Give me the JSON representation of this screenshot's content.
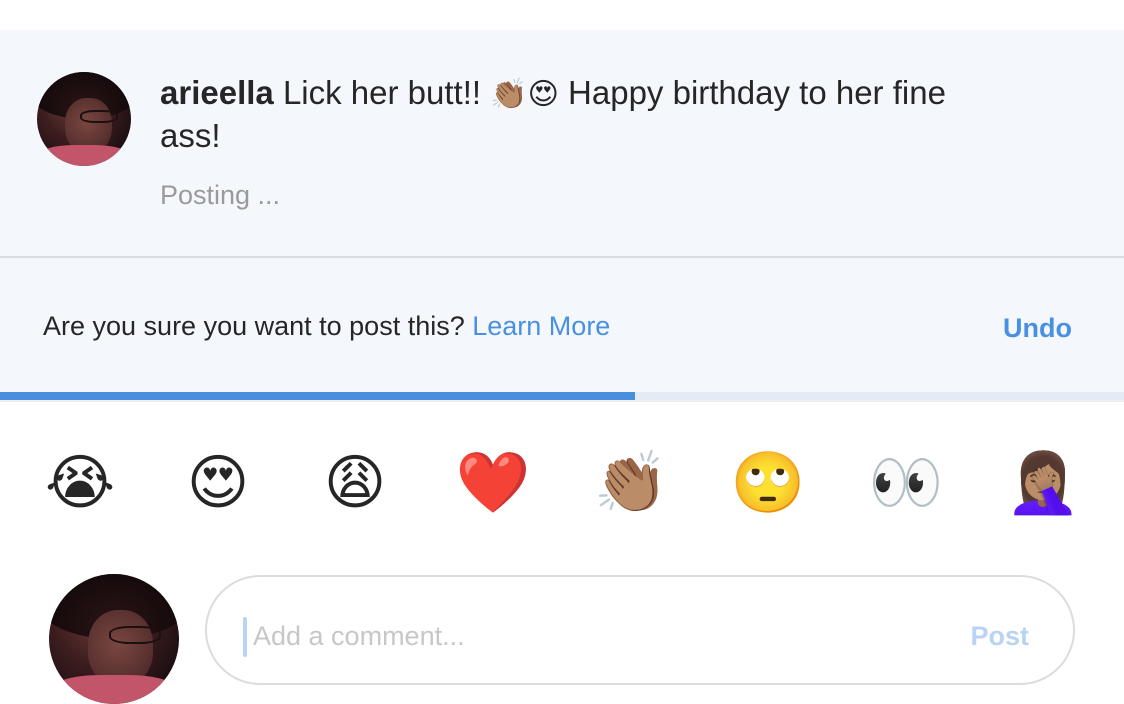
{
  "comment": {
    "username": "arieella",
    "text_part1": "Lick her butt!!",
    "emoji1": "👏🏽",
    "emoji2": "😍",
    "text_part2": "Happy birthday to her fine ass!",
    "status": "Posting ..."
  },
  "confirm": {
    "question": "Are you sure you want to post this?",
    "learn_more": "Learn More",
    "undo": "Undo"
  },
  "progress": {
    "fraction": 0.565,
    "fill_color": "#4a8ee0"
  },
  "emoji_bar": [
    {
      "name": "loudly-crying-face",
      "glyph": "😭"
    },
    {
      "name": "heart-eyes",
      "glyph": "😍"
    },
    {
      "name": "weary-face",
      "glyph": "😩"
    },
    {
      "name": "red-heart",
      "glyph": "❤️"
    },
    {
      "name": "clapping-hands",
      "glyph": "👏🏽"
    },
    {
      "name": "eye-roll",
      "glyph": "🙄"
    },
    {
      "name": "eyes",
      "glyph": "👀"
    },
    {
      "name": "facepalm",
      "glyph": "🤦🏽‍♀️"
    }
  ],
  "input": {
    "placeholder": "Add a comment...",
    "post_label": "Post"
  },
  "colors": {
    "accent": "#4a90e2",
    "panel_bg": "#f4f8fc",
    "muted_text": "#9a9a9a"
  }
}
